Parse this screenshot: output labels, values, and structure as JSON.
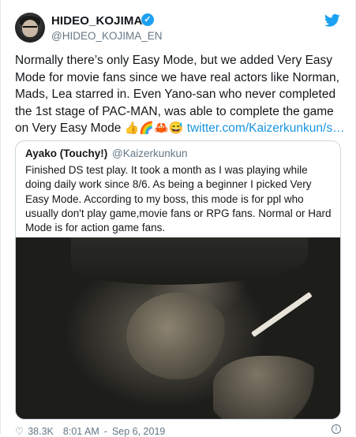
{
  "tweet": {
    "display_name": "HIDEO_KOJIMA",
    "handle": "@HIDEO_KOJIMA_EN",
    "verified_icon": "✓",
    "text_main": "Normally there’s only Easy Mode, but we added Very Easy Mode for movie fans since we have real actors like Norman, Mads, Lea starred in. Even Yano-san who never completed the 1st stage of PAC-MAN, was able to complete the game on Very Easy Mode ",
    "emojis": "👍🌈🦀😅",
    "link": "twitter.com/Kaizerkunkun/s…"
  },
  "quote": {
    "display_name": "Ayako (Touchy!)",
    "handle": "@Kaizerkunkun",
    "text": "Finished DS test play. It took a month as I was playing while doing daily work since 8/6. As being a beginner I picked Very Easy Mode. According to my boss, this mode is for ppl who usually don't play game,movie fans or RPG fans. Normal or Hard Mode is for action game fans."
  },
  "footer": {
    "likes": "38.3K",
    "time": "8:01 AM",
    "date": "Sep 6, 2019"
  },
  "colors": {
    "link": "#1b95e0",
    "verified": "#1da1f2",
    "muted": "#657786",
    "border": "#ccd6dd"
  },
  "icons": {
    "brand": "twitter-bird-icon",
    "like": "heart-icon",
    "info": "info-icon"
  }
}
